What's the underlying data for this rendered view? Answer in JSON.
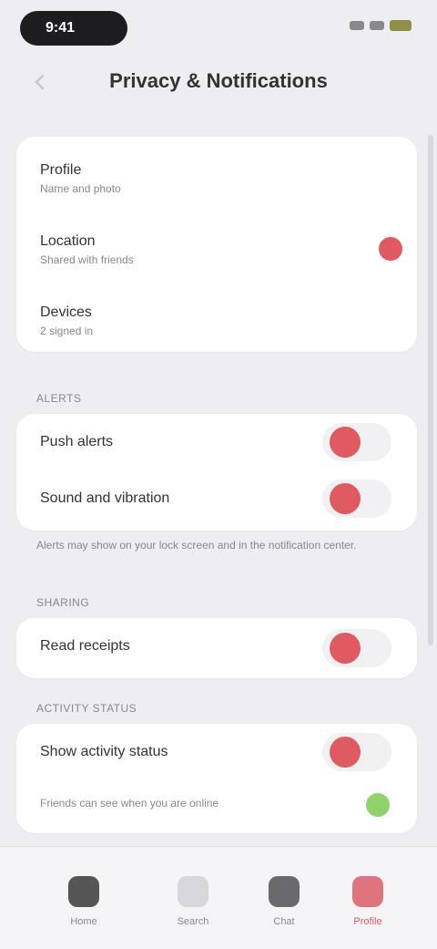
{
  "status": {
    "time": "9:41"
  },
  "nav": {
    "title": "Privacy & Notifications"
  },
  "card1": {
    "rows": [
      {
        "label": "Profile",
        "sub": "Name and photo"
      },
      {
        "label": "Location",
        "sub": "Shared with friends"
      },
      {
        "label": "Devices",
        "sub": "2 signed in"
      }
    ]
  },
  "section2": {
    "label": "ALERTS",
    "rows": [
      {
        "label": "Push alerts"
      },
      {
        "label": "Sound and vibration"
      }
    ],
    "note": "Alerts may show on your lock screen and in the notification center."
  },
  "section3": {
    "label": "SHARING",
    "rows": [
      {
        "label": "Read receipts"
      }
    ]
  },
  "section4": {
    "label": "ACTIVITY STATUS",
    "rows": [
      {
        "label": "Show activity status"
      }
    ],
    "sub": "Friends can see when you are online"
  },
  "tabs": [
    {
      "label": "Home",
      "icon": "home-icon"
    },
    {
      "label": "Search",
      "icon": "search-icon"
    },
    {
      "label": "Chat",
      "icon": "chat-icon"
    },
    {
      "label": "Profile",
      "icon": "profile-icon"
    }
  ],
  "colors": {
    "accent": "#e05a62",
    "positive": "#8fd36a",
    "background": "#eeeef2"
  }
}
